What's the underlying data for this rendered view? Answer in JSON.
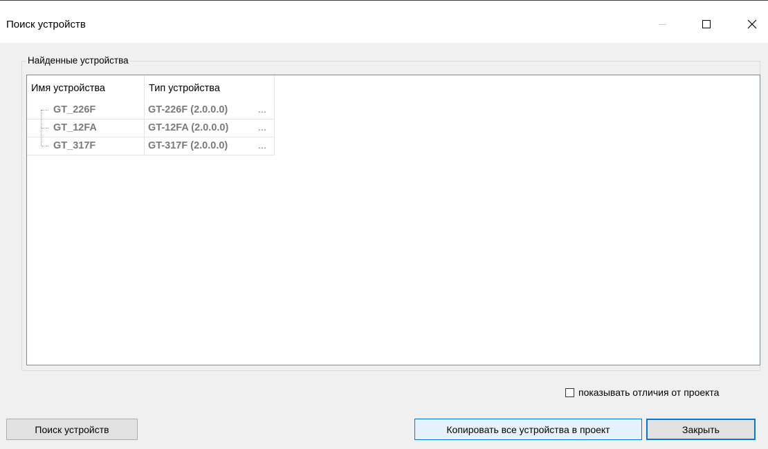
{
  "window": {
    "title": "Поиск устройств"
  },
  "group": {
    "legend": "Найденные устройства"
  },
  "list": {
    "columns": [
      "Имя устройства",
      "Тип устройства"
    ],
    "rows": [
      {
        "name": "GT_226F",
        "type": "GT-226F (2.0.0.0)",
        "more": "..."
      },
      {
        "name": "GT_12FA",
        "type": "GT-12FA (2.0.0.0)",
        "more": "..."
      },
      {
        "name": "GT_317F",
        "type": "GT-317F (2.0.0.0)",
        "more": "..."
      }
    ]
  },
  "options": {
    "show_diff_label": "показывать отличия от проекта",
    "show_diff_checked": false
  },
  "buttons": {
    "search": "Поиск устройств",
    "copy_all": "Копировать все устройства в проект",
    "close": "Закрыть"
  },
  "icons": {
    "minimize": "minimize-icon",
    "maximize": "maximize-icon",
    "close": "close-icon"
  }
}
